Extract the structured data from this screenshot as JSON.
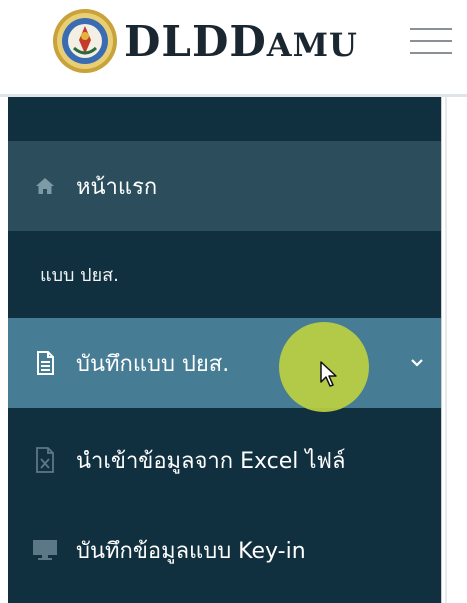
{
  "header": {
    "brand_big_1": "DLD",
    "brand_small": "AMU",
    "brand_big_2": "D",
    "logo_icon": "government-seal-icon",
    "menu_icon": "hamburger-menu-icon"
  },
  "sidebar": {
    "items": [
      {
        "label": "หน้าแรก",
        "icon": "home-icon"
      },
      {
        "label": "บันทึกแบบ ปยส.",
        "icon": "document-icon"
      },
      {
        "label": "นำเข้าข้อมูลจาก Excel ไฟล์",
        "icon": "excel-file-icon"
      },
      {
        "label": "บันทึกข้อมูลแบบ Key-in",
        "icon": "monitor-icon"
      }
    ],
    "section_label": "แบบ ปยส."
  },
  "colors": {
    "sidebar_bg": "#11303f",
    "home_bg": "#2c4d5c",
    "active_bg": "#477d94",
    "cursor_highlight": "#bcd040"
  }
}
